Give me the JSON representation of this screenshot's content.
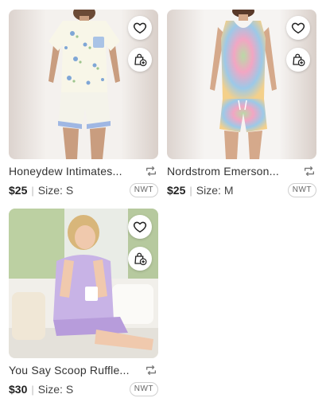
{
  "listings": [
    {
      "title": "Honeydew Intimates...",
      "price": "$25",
      "size_label": "Size:",
      "size": "S",
      "condition": "NWT"
    },
    {
      "title": "Nordstrom Emerson...",
      "price": "$25",
      "size_label": "Size:",
      "size": "M",
      "condition": "NWT"
    },
    {
      "title": "You Say Scoop Ruffle...",
      "price": "$30",
      "size_label": "Size:",
      "size": "S",
      "condition": "NWT"
    }
  ],
  "icons": {
    "like": "heart-icon",
    "bundle": "shopping-bag-plus-icon",
    "share": "repost-icon"
  }
}
